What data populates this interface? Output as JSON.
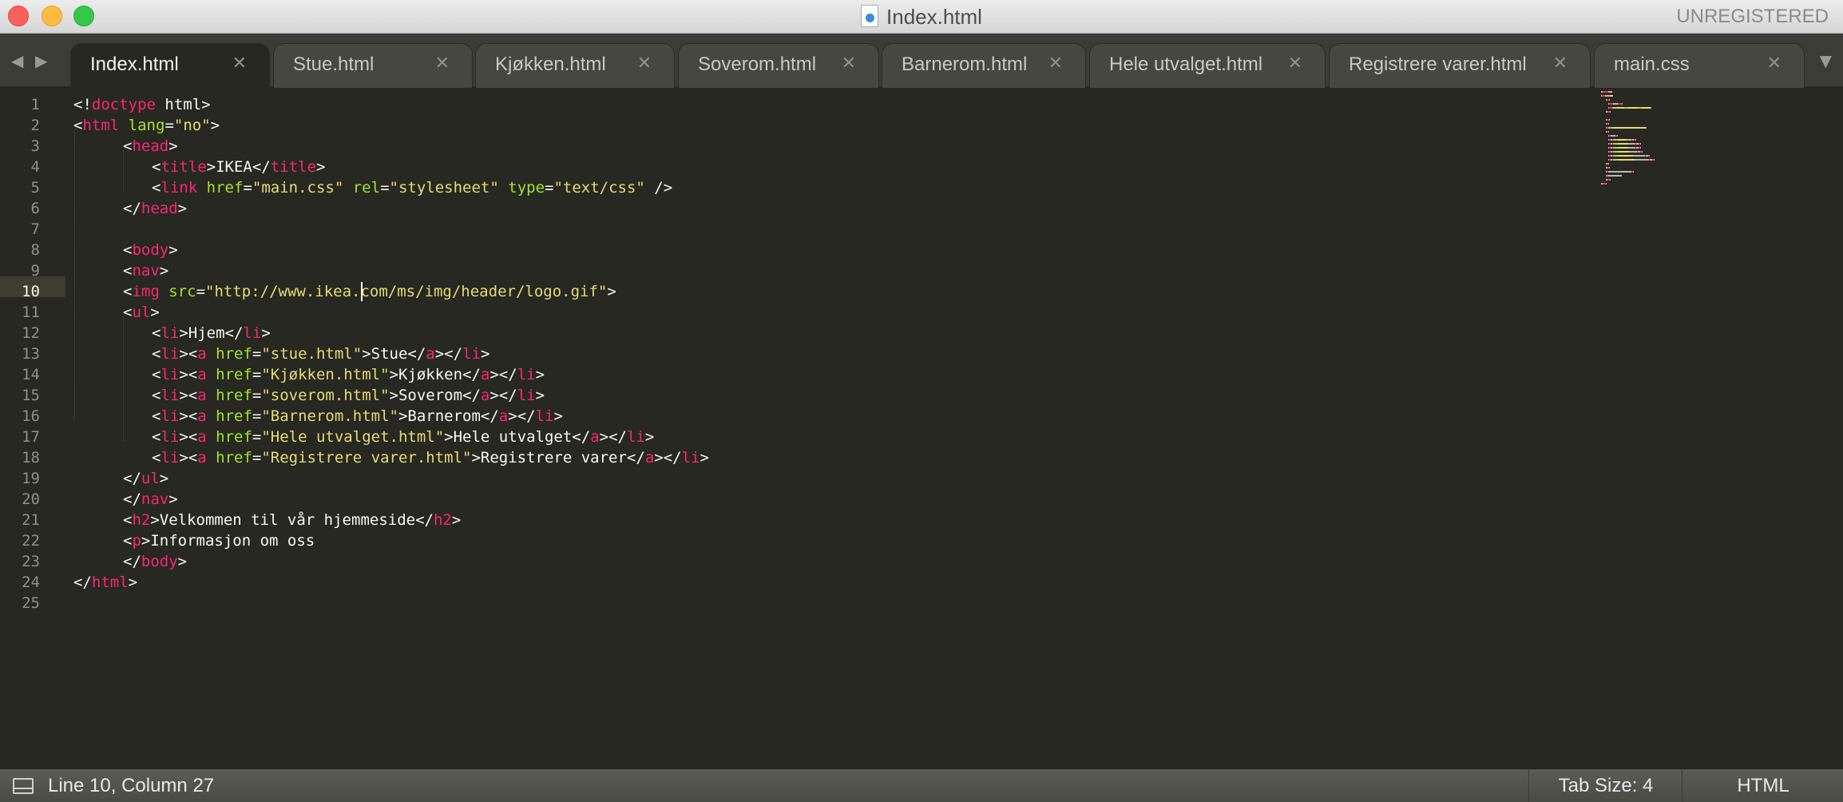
{
  "window": {
    "title": "Index.html",
    "unregistered_label": "UNREGISTERED"
  },
  "tabs": [
    {
      "label": "Index.html",
      "active": true
    },
    {
      "label": "Stue.html",
      "active": false
    },
    {
      "label": "Kjøkken.html",
      "active": false
    },
    {
      "label": "Soverom.html",
      "active": false
    },
    {
      "label": "Barnerom.html",
      "active": false
    },
    {
      "label": "Hele utvalget.html",
      "active": false
    },
    {
      "label": "Registrere varer.html",
      "active": false
    },
    {
      "label": "main.css",
      "active": false
    }
  ],
  "icons": {
    "tab_close": "close-icon",
    "nav_back": "arrow-left-icon",
    "nav_forward": "arrow-right-icon",
    "tab_overflow": "chevron-down-icon",
    "status_panel": "panel-toggle-icon",
    "file": "html-file-icon"
  },
  "editor": {
    "current_line": 10,
    "theme_colors": {
      "background": "#272822",
      "tag": "#f92672",
      "attribute": "#a6e22e",
      "string": "#e6db74",
      "text": "#f8f8f2",
      "line_number": "#8f908a"
    },
    "lines": [
      [
        [
          "p",
          "<!"
        ],
        [
          "t",
          "doctype"
        ],
        [
          "p",
          " html>"
        ]
      ],
      [
        [
          "p",
          "<"
        ],
        [
          "t",
          "html"
        ],
        [
          "p",
          " "
        ],
        [
          "a",
          "lang"
        ],
        [
          "p",
          "="
        ],
        [
          "s",
          "\"no\""
        ],
        [
          "p",
          ">"
        ]
      ],
      [
        [
          "p",
          "<"
        ],
        [
          "t",
          "head"
        ],
        [
          "p",
          ">"
        ]
      ],
      [
        [
          "p",
          "<"
        ],
        [
          "t",
          "title"
        ],
        [
          "p",
          ">IKEA</"
        ],
        [
          "t",
          "title"
        ],
        [
          "p",
          ">"
        ]
      ],
      [
        [
          "p",
          "<"
        ],
        [
          "t",
          "link"
        ],
        [
          "p",
          " "
        ],
        [
          "a",
          "href"
        ],
        [
          "p",
          "="
        ],
        [
          "s",
          "\"main.css\""
        ],
        [
          "p",
          " "
        ],
        [
          "a",
          "rel"
        ],
        [
          "p",
          "="
        ],
        [
          "s",
          "\"stylesheet\""
        ],
        [
          "p",
          " "
        ],
        [
          "a",
          "type"
        ],
        [
          "p",
          "="
        ],
        [
          "s",
          "\"text/css\""
        ],
        [
          "p",
          " />"
        ]
      ],
      [
        [
          "p",
          "</"
        ],
        [
          "t",
          "head"
        ],
        [
          "p",
          ">"
        ]
      ],
      [],
      [
        [
          "p",
          "<"
        ],
        [
          "t",
          "body"
        ],
        [
          "p",
          ">"
        ]
      ],
      [
        [
          "p",
          "<"
        ],
        [
          "t",
          "nav"
        ],
        [
          "p",
          ">"
        ]
      ],
      [
        [
          "p",
          "<"
        ],
        [
          "t",
          "img"
        ],
        [
          "p",
          " "
        ],
        [
          "a",
          "src"
        ],
        [
          "p",
          "="
        ],
        [
          "s",
          "\"http://www.ikea.com/ms/img/header/logo.gif\""
        ],
        [
          "p",
          ">"
        ]
      ],
      [
        [
          "p",
          "<"
        ],
        [
          "t",
          "ul"
        ],
        [
          "p",
          ">"
        ]
      ],
      [
        [
          "p",
          "<"
        ],
        [
          "t",
          "li"
        ],
        [
          "p",
          ">Hjem</"
        ],
        [
          "t",
          "li"
        ],
        [
          "p",
          ">"
        ]
      ],
      [
        [
          "p",
          "<"
        ],
        [
          "t",
          "li"
        ],
        [
          "p",
          "><"
        ],
        [
          "t",
          "a"
        ],
        [
          "p",
          " "
        ],
        [
          "a",
          "href"
        ],
        [
          "p",
          "="
        ],
        [
          "s",
          "\"stue.html\""
        ],
        [
          "p",
          ">Stue</"
        ],
        [
          "t",
          "a"
        ],
        [
          "p",
          "></"
        ],
        [
          "t",
          "li"
        ],
        [
          "p",
          ">"
        ]
      ],
      [
        [
          "p",
          "<"
        ],
        [
          "t",
          "li"
        ],
        [
          "p",
          "><"
        ],
        [
          "t",
          "a"
        ],
        [
          "p",
          " "
        ],
        [
          "a",
          "href"
        ],
        [
          "p",
          "="
        ],
        [
          "s",
          "\"Kjøkken.html\""
        ],
        [
          "p",
          ">Kjøkken</"
        ],
        [
          "t",
          "a"
        ],
        [
          "p",
          "></"
        ],
        [
          "t",
          "li"
        ],
        [
          "p",
          ">"
        ]
      ],
      [
        [
          "p",
          "<"
        ],
        [
          "t",
          "li"
        ],
        [
          "p",
          "><"
        ],
        [
          "t",
          "a"
        ],
        [
          "p",
          " "
        ],
        [
          "a",
          "href"
        ],
        [
          "p",
          "="
        ],
        [
          "s",
          "\"soverom.html\""
        ],
        [
          "p",
          ">Soverom</"
        ],
        [
          "t",
          "a"
        ],
        [
          "p",
          "></"
        ],
        [
          "t",
          "li"
        ],
        [
          "p",
          ">"
        ]
      ],
      [
        [
          "p",
          "<"
        ],
        [
          "t",
          "li"
        ],
        [
          "p",
          "><"
        ],
        [
          "t",
          "a"
        ],
        [
          "p",
          " "
        ],
        [
          "a",
          "href"
        ],
        [
          "p",
          "="
        ],
        [
          "s",
          "\"Barnerom.html\""
        ],
        [
          "p",
          ">Barnerom</"
        ],
        [
          "t",
          "a"
        ],
        [
          "p",
          "></"
        ],
        [
          "t",
          "li"
        ],
        [
          "p",
          ">"
        ]
      ],
      [
        [
          "p",
          "<"
        ],
        [
          "t",
          "li"
        ],
        [
          "p",
          "><"
        ],
        [
          "t",
          "a"
        ],
        [
          "p",
          " "
        ],
        [
          "a",
          "href"
        ],
        [
          "p",
          "="
        ],
        [
          "s",
          "\"Hele utvalget.html\""
        ],
        [
          "p",
          ">Hele utvalget</"
        ],
        [
          "t",
          "a"
        ],
        [
          "p",
          "></"
        ],
        [
          "t",
          "li"
        ],
        [
          "p",
          ">"
        ]
      ],
      [
        [
          "p",
          "<"
        ],
        [
          "t",
          "li"
        ],
        [
          "p",
          "><"
        ],
        [
          "t",
          "a"
        ],
        [
          "p",
          " "
        ],
        [
          "a",
          "href"
        ],
        [
          "p",
          "="
        ],
        [
          "s",
          "\"Registrere varer.html\""
        ],
        [
          "p",
          ">Registrere varer</"
        ],
        [
          "t",
          "a"
        ],
        [
          "p",
          "></"
        ],
        [
          "t",
          "li"
        ],
        [
          "p",
          ">"
        ]
      ],
      [
        [
          "p",
          "</"
        ],
        [
          "t",
          "ul"
        ],
        [
          "p",
          ">"
        ]
      ],
      [
        [
          "p",
          "</"
        ],
        [
          "t",
          "nav"
        ],
        [
          "p",
          ">"
        ]
      ],
      [
        [
          "p",
          "<"
        ],
        [
          "t",
          "h2"
        ],
        [
          "p",
          ">Velkommen til vår hjemmeside</"
        ],
        [
          "t",
          "h2"
        ],
        [
          "p",
          ">"
        ]
      ],
      [
        [
          "p",
          "<"
        ],
        [
          "t",
          "p"
        ],
        [
          "p",
          ">Informasjon om oss"
        ]
      ],
      [
        [
          "p",
          "</"
        ],
        [
          "t",
          "body"
        ],
        [
          "p",
          ">"
        ]
      ],
      [
        [
          "p",
          "</"
        ],
        [
          "t",
          "html"
        ],
        [
          "p",
          ">"
        ]
      ],
      []
    ]
  },
  "statusbar": {
    "position": "Line 10, Column 27",
    "tab_size": "Tab Size: 4",
    "syntax": "HTML"
  }
}
